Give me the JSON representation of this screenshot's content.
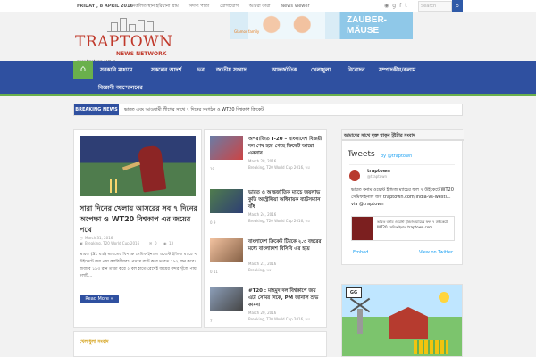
{
  "topbar": {
    "date": "FRIDAY , 8 APRIL 2016",
    "nav": [
      "সকলিত স্থান হরিয়ানা গ্রাম",
      "সদস্য পাতা",
      "যোগাযোগ",
      "আমরা কারা",
      "News Viewer"
    ],
    "search_placeholder": "Search",
    "search_icon": "search-icon",
    "social_icons": [
      "rss-icon",
      "gplus-icon",
      "facebook-icon",
      "twitter-icon"
    ]
  },
  "logo": {
    "brand": "TRAPTOWN",
    "subtitle": "NEWS NETWORK",
    "url": "www.traptown.com.in"
  },
  "ad": {
    "brand": "Glamor family",
    "headline": "ZAUBER-MÄUSE"
  },
  "mainnav": {
    "home_icon": "home-icon",
    "items": [
      "সরকারি মাধ্যমে",
      "সকলের আদর্শ",
      "ভর",
      "জাতীয় সংবাদ",
      "আন্তর্জাতিক",
      "খেলাধুলা",
      "বিনোদন",
      "সম্পাদকীয়/কলাম"
    ],
    "row2": [
      "বিজ্ঞানী আন্দোলনের"
    ]
  },
  "breaking": {
    "label": "BREAKING NEWS",
    "text": "ভারত এবং আওয়ামী লীগের সাথে ৭ দিনের সংগঠন ও WT20 বিশ্বকাপ ক্রিকেট"
  },
  "featured": {
    "title": "সারা দিনের খেলায় আসরের সব ৭ দিনের অপেক্ষা ও WT20 বিশ্বকাপ এর জয়ের পথে",
    "date": "March 31, 2016",
    "meta": "Breaking, T20 World Cup 2016",
    "comments": "0",
    "views": "13",
    "excerpt": "ভারত (31 মার্চ) ভারতের বিপক্ষে সেমিফাইনালে ওয়েস্ট ইন্ডিজ ম্যাচে ৭ উইকেটে জয় পায় ক্যারিবীয়রা। প্রথমে ব্যাট করে ভারত ১৯২ রান করে। জবাবে ১৯৩ রান তাড়া করে ২ বল হাতে রেখেই জয়ের বন্দর খুঁজে পায় দলটি...",
    "read_more": "Read More »"
  },
  "posts": [
    {
      "title": "অপরাজিত T-20 – বাংলাদেশ বিজয়ী দল শেষ হয়ে গেছে ক্রিকেট আরো একবার",
      "date": "March 28, 2016",
      "meta": "Breaking, T20 World Cup 2016, ভর",
      "stats": "19"
    },
    {
      "title": "ভারত ও আন্তর্জাতিক ম্যাচে জয়লাভ কুড়ি অস্ট্রেলিয়া অধিনায়ক ব্যাটসম্যান বাঁধ",
      "date": "March 24, 2016",
      "meta": "Breaking, T20 World Cup 2016, ভর",
      "stats": "0 9"
    },
    {
      "title": "বাংলাদেশ ক্রিকেট টিমকে ২.৩ বছরের মধ্যে বাংলাদেশ বিসিবি এর হয়ে",
      "date": "March 21, 2016",
      "meta": "Breaking, ভর",
      "stats": "0 11"
    },
    {
      "title": "#T20 : মাহমুদ দল বিশ্বকাপে জয় এটা সেমির দিকে, PM জানাল শুভ কামনা",
      "date": "March 20, 2016",
      "meta": "Breaking, T20 World Cup 2016, ভর",
      "stats": "7"
    }
  ],
  "sidebar": {
    "title": "আমাদের সাথে যুক্ত থাকুন টুইটার সংবাদ",
    "tweets_label": "Tweets",
    "byline": "by @traptown",
    "tweet_name": "traptown",
    "tweet_handle": "@traptown",
    "tweet_text": "ভারত বনাম ওয়েস্ট ইন্ডিজ ম্যাচের ফল ৭ উইকেটে WT20 সেমিফাইনাল জয় traptown.com/india-vs-westi... via @traptown",
    "card_text": "ভারত বনাম ওয়েস্ট ইন্ডিজ ম্যাচের ফল ৭ উইকেটে WT20 সেমিফাইনাল traptown.com",
    "embed": "Embed",
    "view_on": "View on Twitter"
  },
  "bottom": {
    "title": "খেলাধুলা সংবাদ"
  },
  "adpanel": {
    "logo": "GG"
  }
}
